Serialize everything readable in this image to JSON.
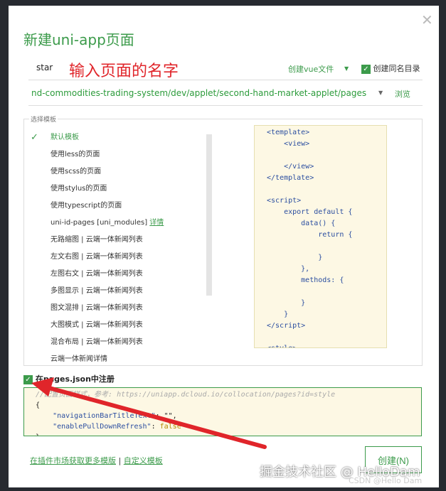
{
  "dialog": {
    "title": "新建uni-app页面",
    "page_name": "star",
    "annotation": "输入页面的名字",
    "file_type": "创建vue文件",
    "same_dir_label": "创建同名目录",
    "path": "nd-commodities-trading-system/dev/applet/second-hand-market-applet/pages",
    "browse": "浏览",
    "template_group_label": "选择模板",
    "templates": [
      {
        "label": "默认模板",
        "selected": true
      },
      {
        "label": "使用less的页面"
      },
      {
        "label": "使用scss的页面"
      },
      {
        "label": "使用stylus的页面"
      },
      {
        "label": "使用typescript的页面"
      },
      {
        "label": "uni-id-pages [uni_modules]",
        "link": "详情"
      },
      {
        "label": "无路缩图 | 云端一体新闻列表"
      },
      {
        "label": "左文右图 | 云端一体新闻列表"
      },
      {
        "label": "左图右文 | 云端一体新闻列表"
      },
      {
        "label": "多图显示 | 云端一体新闻列表"
      },
      {
        "label": "图文混排 | 云端一体新闻列表"
      },
      {
        "label": "大图模式 | 云端一体新闻列表"
      },
      {
        "label": "混合布局 | 云端一体新闻列表"
      },
      {
        "label": "云端一体新闻详情"
      }
    ],
    "preview_code": "<template>\n    <view>\n        \n    </view>\n</template>\n\n<script>\n    export default {\n        data() {\n            return {\n                \n            }\n        },\n        methods: {\n            \n        }\n    }\n</script>\n\n<style>",
    "register_label": "在pages.json中注册",
    "json_comment": "//配置页面样式，参考: https://uniapp.dcloud.io/collocation/pages?id=style",
    "json_open": "{",
    "json_line1_key": "    \"navigationBarTitleText\"",
    "json_line1_val": ": \"\",",
    "json_line2_key": "    \"enablePullDownRefresh\"",
    "json_line2_val": "false",
    "json_close": "}",
    "market_link": "在插件市场获取更多模版",
    "separator": "|",
    "custom_link": "自定义模板",
    "create_button": "创建(N)"
  },
  "watermark": {
    "juejin": "掘金技术社区 @ HelloDam",
    "csdn": "CSDN @Hello Dam"
  }
}
